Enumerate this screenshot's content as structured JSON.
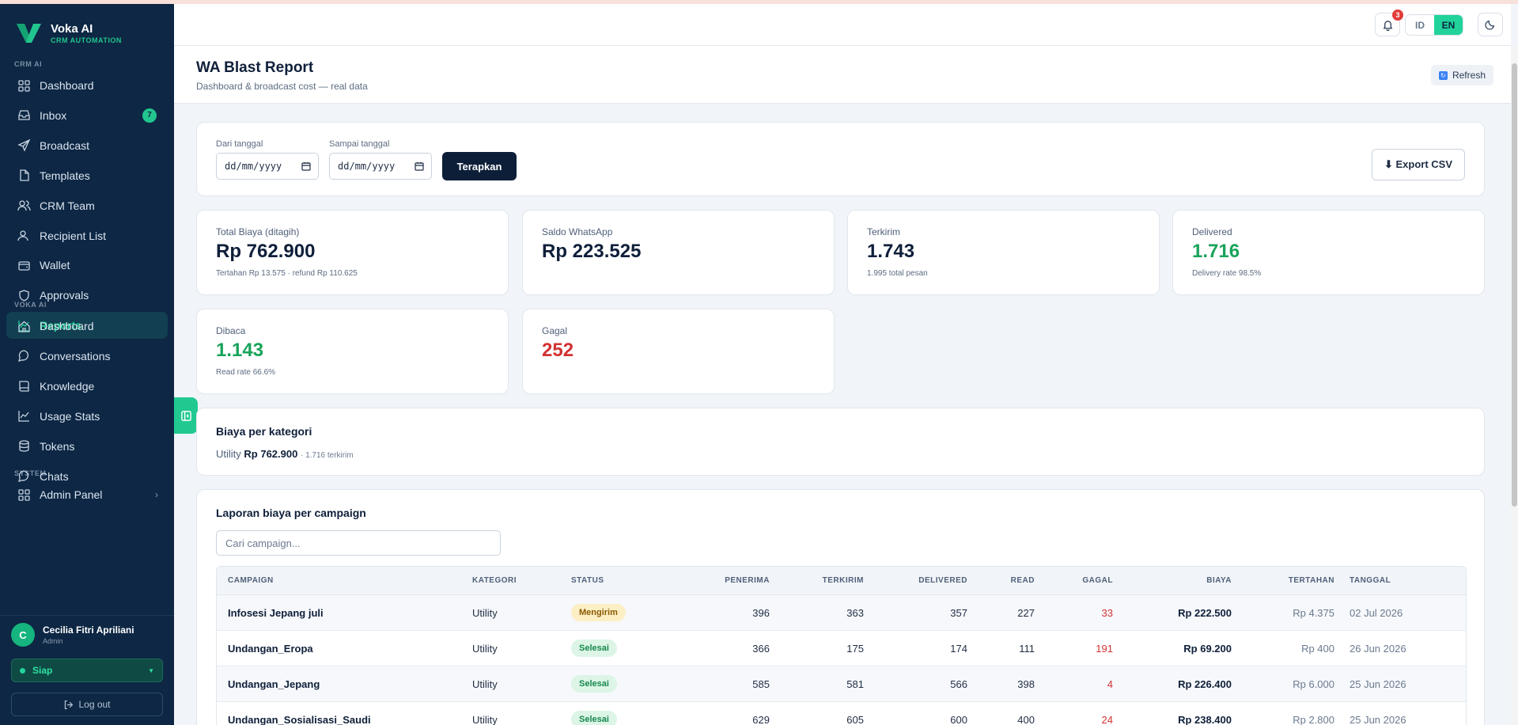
{
  "brand": {
    "name": "Voka AI",
    "sub": "CRM AUTOMATION"
  },
  "sidebar": {
    "sections": [
      {
        "label": "CRM AI"
      },
      {
        "label": "VOKA AI"
      },
      {
        "label": "SYSTEM"
      }
    ],
    "crm_items": [
      {
        "label": "Dashboard",
        "icon": "grid-icon"
      },
      {
        "label": "Inbox",
        "icon": "inbox-icon",
        "badge": "7"
      },
      {
        "label": "Broadcast",
        "icon": "send-icon"
      },
      {
        "label": "Templates",
        "icon": "file-icon"
      },
      {
        "label": "CRM Team",
        "icon": "users-icon"
      },
      {
        "label": "Recipient List",
        "icon": "user-list-icon"
      },
      {
        "label": "Wallet",
        "icon": "wallet-icon"
      },
      {
        "label": "Approvals",
        "icon": "shield-icon"
      },
      {
        "label": "Reports",
        "icon": "chart-icon",
        "active": true
      }
    ],
    "voka_items": [
      {
        "label": "Dashboard",
        "icon": "home-icon"
      },
      {
        "label": "Conversations",
        "icon": "message-icon"
      },
      {
        "label": "Knowledge",
        "icon": "book-icon"
      },
      {
        "label": "Usage Stats",
        "icon": "chart-icon"
      },
      {
        "label": "Tokens",
        "icon": "database-icon"
      },
      {
        "label": "Chats",
        "icon": "chat-icon"
      }
    ],
    "system_items": [
      {
        "label": "Admin Panel",
        "icon": "grid-icon",
        "chevron": "›"
      }
    ],
    "user": {
      "initial": "C",
      "name": "Cecilia Fitri Apriliani",
      "role": "Admin"
    },
    "status": "Siap",
    "logout": "Log out"
  },
  "topbar": {
    "notifications": "3",
    "lang_id": "ID",
    "lang_en": "EN"
  },
  "header": {
    "title": "WA Blast Report",
    "subtitle": "Dashboard & broadcast cost — real data",
    "refresh": "Refresh"
  },
  "filters": {
    "from_label": "Dari tanggal",
    "to_label": "Sampai tanggal",
    "from_value": "dd/mm/yyyy",
    "to_value": "dd/mm/yyyy",
    "apply": "Terapkan",
    "export": "⬇ Export CSV"
  },
  "stats": [
    {
      "label": "Total Biaya (ditagih)",
      "value": "Rp 762.900",
      "sub": "Tertahan Rp 13.575 · refund Rp 110.625",
      "tone": ""
    },
    {
      "label": "Saldo WhatsApp",
      "value": "Rp 223.525",
      "sub": "",
      "tone": ""
    },
    {
      "label": "Terkirim",
      "value": "1.743",
      "sub": "1.995 total pesan",
      "tone": ""
    },
    {
      "label": "Delivered",
      "value": "1.716",
      "sub": "Delivery rate 98.5%",
      "tone": "green"
    },
    {
      "label": "Dibaca",
      "value": "1.143",
      "sub": "Read rate 66.6%",
      "tone": "green"
    },
    {
      "label": "Gagal",
      "value": "252",
      "sub": "",
      "tone": "red"
    }
  ],
  "category": {
    "title": "Biaya per kategori",
    "name": "Utility",
    "amount": "Rp 762.900",
    "sent": "· 1.716 terkirim"
  },
  "report": {
    "title": "Laporan biaya per campaign",
    "search_placeholder": "Cari campaign...",
    "columns": [
      "CAMPAIGN",
      "KATEGORI",
      "STATUS",
      "PENERIMA",
      "TERKIRIM",
      "DELIVERED",
      "READ",
      "GAGAL",
      "BIAYA",
      "TERTAHAN",
      "TANGGAL"
    ],
    "rows": [
      {
        "campaign": "Infosesi Jepang juli",
        "kategori": "Utility",
        "status": "Mengirim",
        "status_tone": "warn",
        "penerima": "396",
        "terkirim": "363",
        "delivered": "357",
        "read": "227",
        "gagal": "33",
        "biaya": "Rp 222.500",
        "tertahan": "Rp 4.375",
        "tanggal": "02 Jul 2026"
      },
      {
        "campaign": "Undangan_Eropa",
        "kategori": "Utility",
        "status": "Selesai",
        "status_tone": "ok",
        "penerima": "366",
        "terkirim": "175",
        "delivered": "174",
        "read": "111",
        "gagal": "191",
        "biaya": "Rp 69.200",
        "tertahan": "Rp 400",
        "tanggal": "26 Jun 2026"
      },
      {
        "campaign": "Undangan_Jepang",
        "kategori": "Utility",
        "status": "Selesai",
        "status_tone": "ok",
        "penerima": "585",
        "terkirim": "581",
        "delivered": "566",
        "read": "398",
        "gagal": "4",
        "biaya": "Rp 226.400",
        "tertahan": "Rp 6.000",
        "tanggal": "25 Jun 2026"
      },
      {
        "campaign": "Undangan_Sosialisasi_Saudi",
        "kategori": "Utility",
        "status": "Selesai",
        "status_tone": "ok",
        "penerima": "629",
        "terkirim": "605",
        "delivered": "600",
        "read": "400",
        "gagal": "24",
        "biaya": "Rp 238.400",
        "tertahan": "Rp 2.800",
        "tanggal": "25 Jun 2026"
      }
    ]
  },
  "colors": {
    "sidebar_bg": "#0d2744",
    "accent": "#21d39a",
    "danger": "#d23232",
    "success": "#18a35a"
  }
}
